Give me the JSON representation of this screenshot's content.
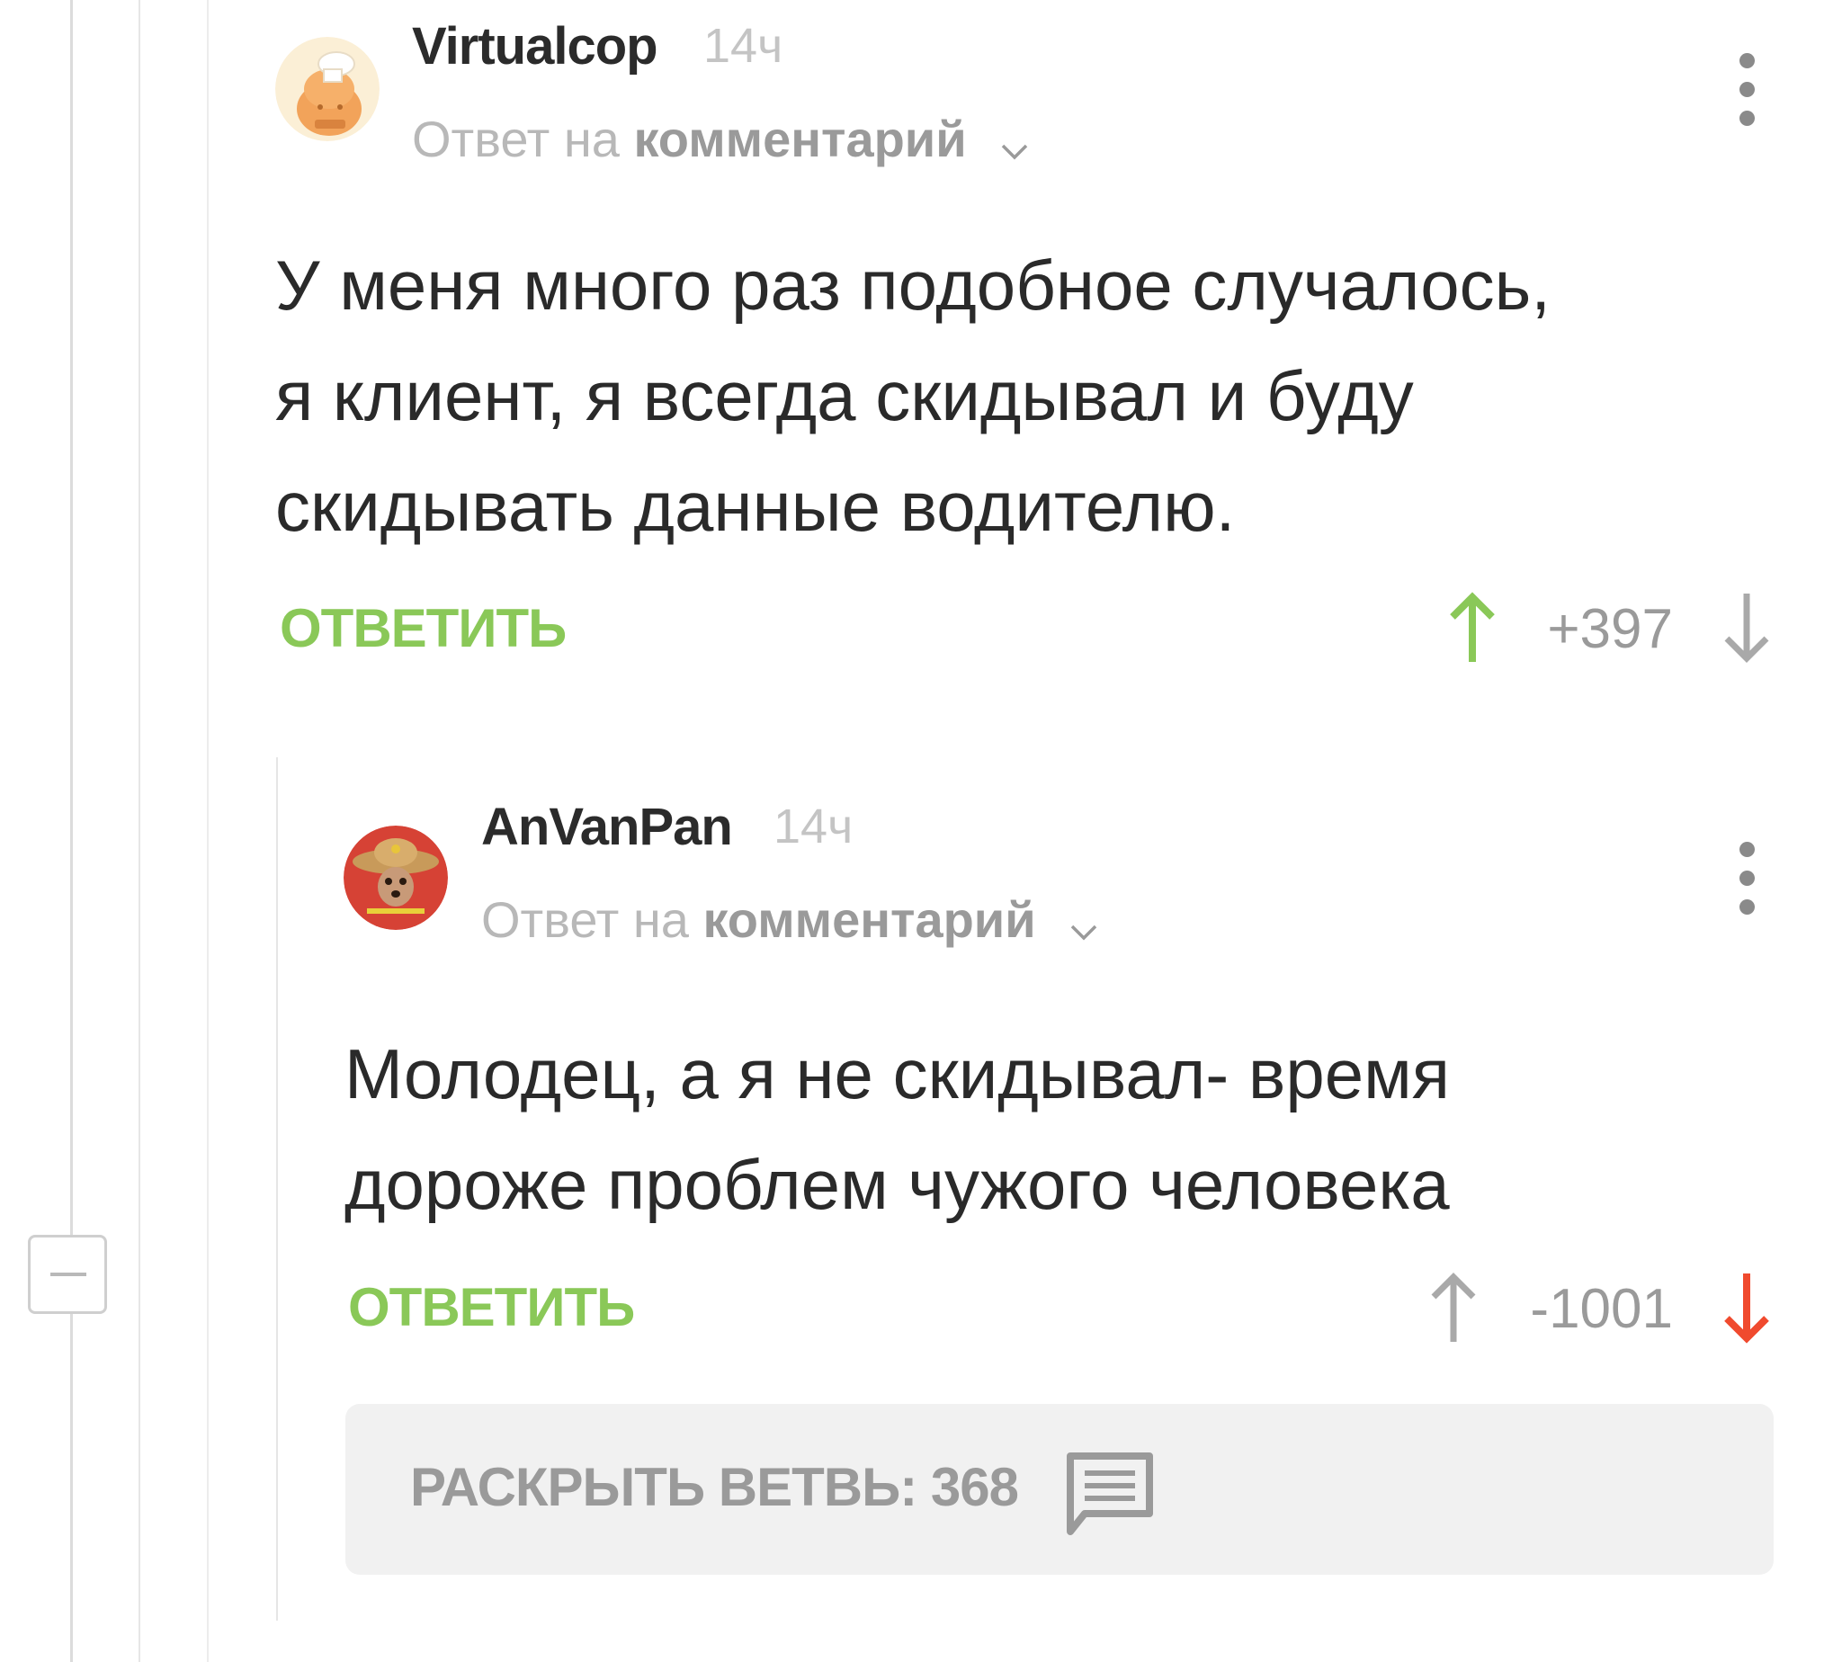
{
  "comments": [
    {
      "username": "Virtualcop",
      "time": "14ч",
      "reply_prefix": "Ответ на",
      "reply_target": "комментарий",
      "body_lines": [
        "У меня много раз подобное случалось,",
        "я клиент, я всегда скидывал и буду",
        "скидывать данные водителю."
      ],
      "reply_label": "ОТВЕТИТЬ",
      "rating": "+397",
      "vote_state": "up"
    },
    {
      "username": "AnVanPan",
      "time": "14ч",
      "reply_prefix": "Ответ на",
      "reply_target": "комментарий",
      "body_lines": [
        "Молодец, а я не скидывал- время",
        "дороже проблем чужого человека"
      ],
      "reply_label": "ОТВЕТИТЬ",
      "rating": "-1001",
      "vote_state": "down"
    }
  ],
  "expand_branch": {
    "label": "РАСКРЫТЬ ВЕТВЬ: 368",
    "icon": "comments-icon"
  },
  "colors": {
    "accent_green": "#8ac858",
    "downvote_red": "#f04a2e",
    "muted_gray": "#9a9a9a"
  },
  "icons": {
    "upvote": "arrow-up-icon",
    "downvote": "arrow-down-icon",
    "more": "more-vertical-icon",
    "collapse": "minus-icon",
    "chevron": "chevron-down-icon"
  }
}
